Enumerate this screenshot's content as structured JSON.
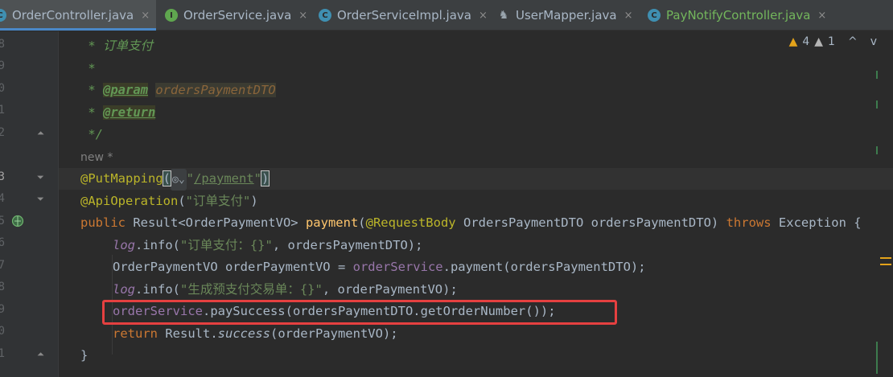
{
  "tabs": [
    {
      "label": "OrderController.java",
      "icon": "class-icon",
      "close": "×",
      "active": true
    },
    {
      "label": "OrderService.java",
      "icon": "interface-icon",
      "close": "×",
      "active": false
    },
    {
      "label": "OrderServiceImpl.java",
      "icon": "class-icon",
      "close": "×",
      "active": false
    },
    {
      "label": "UserMapper.java",
      "icon": "mapper-icon",
      "close": "×",
      "active": false
    },
    {
      "label": "PayNotifyController.java",
      "icon": "class-icon",
      "close": "×",
      "active": false
    }
  ],
  "gutter": {
    "line_numbers": [
      "8",
      "9",
      "0",
      "1",
      "2",
      "",
      "3",
      "4",
      "5",
      "6",
      "7",
      "8",
      "9",
      "0",
      "1"
    ]
  },
  "inspections": {
    "warnings": "4",
    "weak_warnings": "1",
    "prev": "^",
    "next": "v"
  },
  "code": {
    "doc1": " * 订单支付",
    "doc2": " *",
    "doc3_star": " * ",
    "doc3_tag": "@param",
    "doc3_param": "ordersPaymentDTO",
    "doc4_star": " * ",
    "doc4_tag": "@return",
    "doc5": " */",
    "hint_new": "new *",
    "put_ann": "@PutMapping",
    "put_open": "(",
    "put_globe": "◎⌄",
    "put_q1": "\"",
    "put_path": "/payment",
    "put_q2": "\"",
    "put_close": ")",
    "api_ann": "@ApiOperation",
    "api_open": "(",
    "api_str": "\"订单支付\"",
    "api_close": ")",
    "sig_public": "public ",
    "sig_type": "Result<OrderPaymentVO> ",
    "sig_method": "payment",
    "sig_open": "(",
    "sig_reqbody": "@RequestBody ",
    "sig_params": "OrdersPaymentDTO ordersPaymentDTO) ",
    "sig_throws": "throws ",
    "sig_exc": "Exception {",
    "l1_log": "log",
    "l1_info": ".info(",
    "l1_str": "\"订单支付：{}\"",
    "l1_rest": ", ordersPaymentDTO);",
    "l2_a": "OrderPaymentVO orderPaymentVO = ",
    "l2_svc": "orderService",
    "l2_b": ".payment(ordersPaymentDTO);",
    "l3_log": "log",
    "l3_info": ".info(",
    "l3_str": "\"生成预支付交易单：{}\"",
    "l3_rest": ", orderPaymentVO);",
    "l4_svc": "orderService",
    "l4_rest": ".paySuccess(ordersPaymentDTO.getOrderNumber());",
    "l5_return": "return ",
    "l5_result": "Result.",
    "l5_success": "success",
    "l5_rest": "(orderPaymentVO);",
    "close_brace": "}"
  },
  "colors": {
    "highlight_box": "#e54040",
    "accent_tab": "#4a88c7",
    "warning": "#e3a21a"
  }
}
